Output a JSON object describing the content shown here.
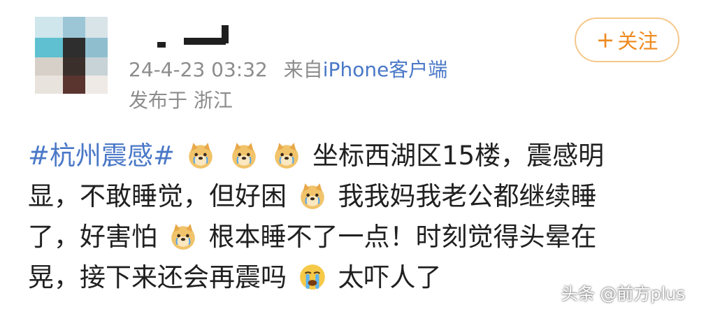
{
  "header": {
    "follow_label": "关注",
    "follow_plus": "+",
    "timestamp": "24-4-23 03:32",
    "source_prefix": "来自",
    "source": "iPhone客户端",
    "location": "发布于 浙江"
  },
  "post": {
    "line1_tag": "#杭州震感#",
    "line1_text": "坐标西湖区15楼，震感明",
    "line2_a": "显，不敢睡觉，但好困",
    "line2_b": "我我妈我老公都继续睡",
    "line3_a": "了，好害怕",
    "line3_b": "根本睡不了一点！时刻觉得头晕在",
    "line4_a": "晃，接下来还会再震吗",
    "line4_b": "太吓人了"
  },
  "icons": {
    "avatar": "blurred-avatar",
    "emoji_doge": "doge-crying-icon",
    "emoji_cry": "crying-face-icon"
  },
  "watermark": "头条 @前方plus",
  "colors": {
    "accent_orange": "#ee8a1f",
    "follow_border": "#f4c88a",
    "link_blue": "#4a78c7",
    "meta_gray": "#8c8c8c"
  }
}
